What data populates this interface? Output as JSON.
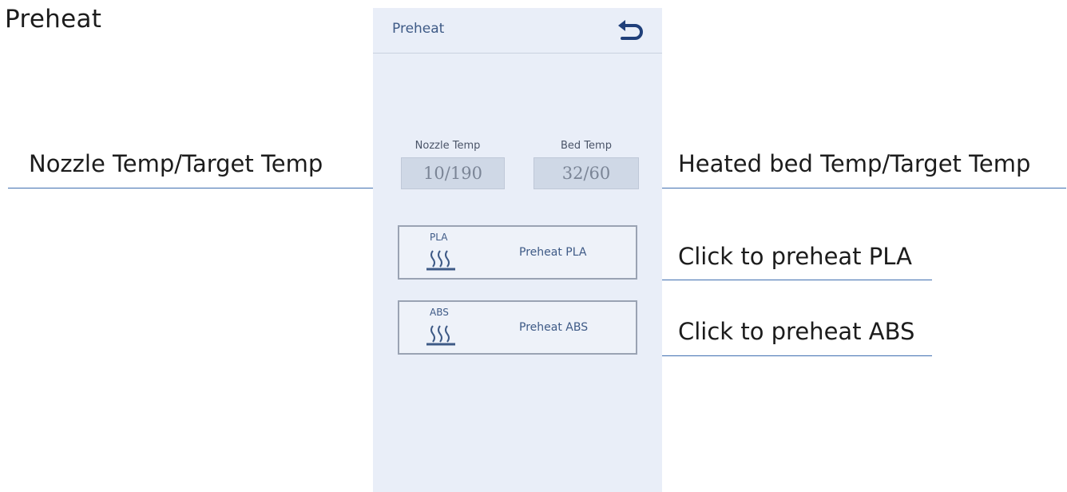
{
  "page_title": "Preheat",
  "screen": {
    "title": "Preheat",
    "nozzle": {
      "label": "Nozzle Temp",
      "value": "10/190"
    },
    "bed": {
      "label": "Bed Temp",
      "value": "32/60"
    },
    "pla": {
      "material": "PLA",
      "label": "Preheat PLA"
    },
    "abs": {
      "material": "ABS",
      "label": "Preheat ABS"
    }
  },
  "annotations": {
    "nozzle": "Nozzle Temp/Target Temp",
    "bed": "Heated bed Temp/Target Temp",
    "pla": "Click to preheat PLA",
    "abs": "Click to preheat ABS"
  },
  "colors": {
    "screen_bg": "#e9eef8",
    "accent_blue": "#3e5a86",
    "leader_line": "#3f6fb0"
  }
}
